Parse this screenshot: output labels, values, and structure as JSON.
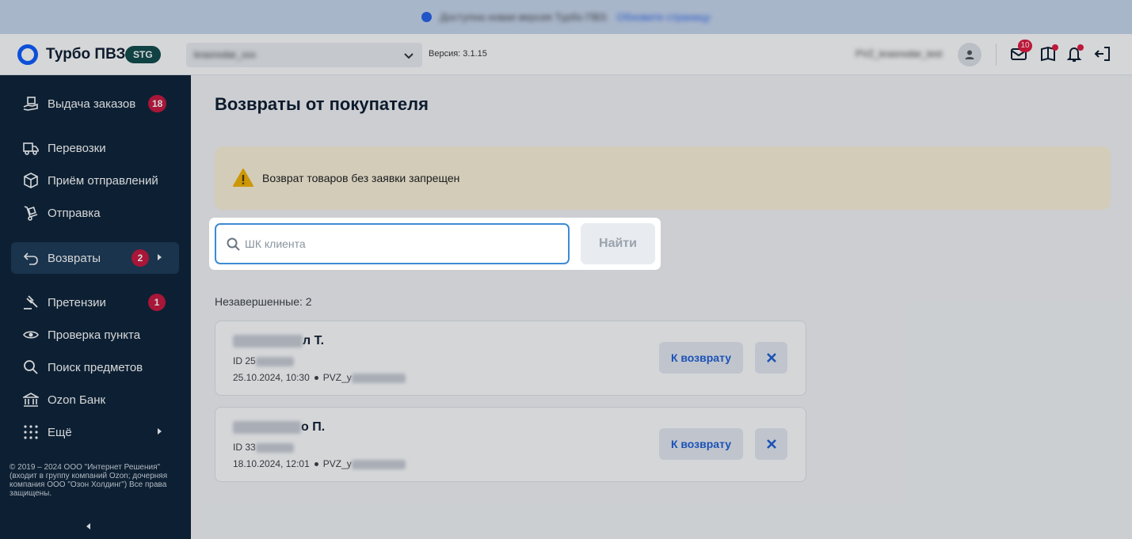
{
  "banner": {
    "text": "Доступна новая версия Турбо ПВЗ.",
    "link": "Обновите страницу"
  },
  "header": {
    "brand": "Турбо ПВЗ",
    "env_badge": "STG",
    "point_select_value": "krasnodar_xxx",
    "version": "Версия: 3.1.15",
    "user_name": "PVZ_krasnodar_test",
    "inbox_count": "10"
  },
  "sidebar": {
    "items": [
      {
        "label": "Выдача заказов",
        "badge": "18"
      },
      {
        "label": "Перевозки"
      },
      {
        "label": "Приём отправлений"
      },
      {
        "label": "Отправка"
      },
      {
        "label": "Возвраты",
        "badge": "2"
      },
      {
        "label": "Претензии",
        "badge": "1"
      },
      {
        "label": "Проверка пункта"
      },
      {
        "label": "Поиск предметов"
      },
      {
        "label": "Ozon Банк"
      },
      {
        "label": "Ещё"
      }
    ],
    "copyright": "© 2019 – 2024 ООО \"Интернет Решения\" (входит в группу компаний Ozon; дочерняя компания ООО \"Озон Холдинг\") Все права защищены."
  },
  "main": {
    "title": "Возвраты от покупателя",
    "warning": "Возврат товаров без заявки запрещен",
    "search": {
      "placeholder": "ШК клиента",
      "button": "Найти"
    },
    "unfinished_label": "Незавершенные: 2",
    "cards": [
      {
        "name_suffix": "л Т.",
        "id_prefix": "ID 25",
        "datetime": "25.10.2024, 10:30",
        "pvz_prefix": "PVZ_у",
        "action": "К возврату"
      },
      {
        "name_suffix": "о П.",
        "id_prefix": "ID 33",
        "datetime": "18.10.2024, 12:01",
        "pvz_prefix": "PVZ_у",
        "action": "К возврату"
      }
    ]
  },
  "colors": {
    "sidebar_bg": "#0b2236",
    "accent": "#0a5cff",
    "badge": "#c8153c",
    "warning_bg": "#fdf3d9",
    "focus_border": "#3d8bd6"
  }
}
